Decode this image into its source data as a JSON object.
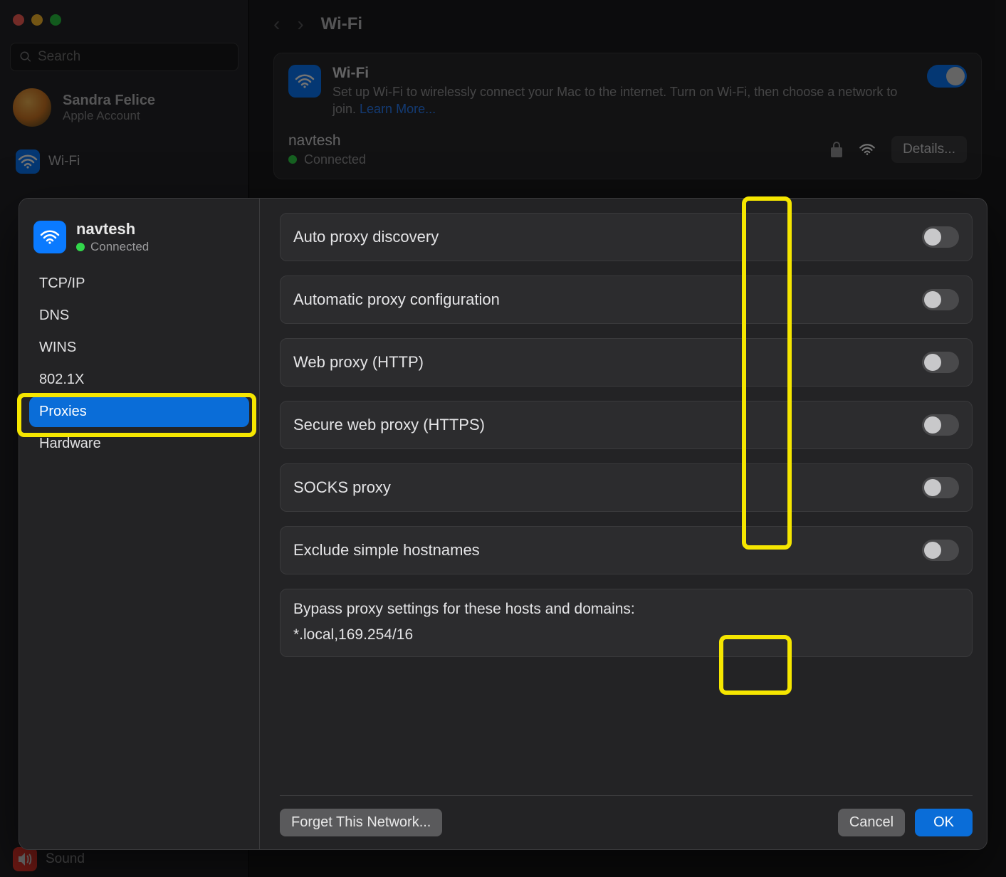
{
  "window": {
    "search_placeholder": "Search",
    "account": {
      "name": "Sandra Felice",
      "subtitle": "Apple Account"
    },
    "nav_wifi": "Wi-Fi",
    "nav_sound": "Sound"
  },
  "main": {
    "title": "Wi-Fi",
    "section": {
      "title": "Wi-Fi",
      "desc_prefix": "Set up Wi-Fi to wirelessly connect your Mac to the internet. Turn on Wi-Fi, then choose a network to join. ",
      "learn_more": "Learn More..."
    },
    "network": {
      "name": "navtesh",
      "status": "Connected",
      "details": "Details..."
    }
  },
  "sheet": {
    "net_name": "navtesh",
    "net_status": "Connected",
    "tabs": {
      "tcpip": "TCP/IP",
      "dns": "DNS",
      "wins": "WINS",
      "dot1x": "802.1X",
      "proxies": "Proxies",
      "hardware": "Hardware"
    },
    "proxies": {
      "auto_discovery": "Auto proxy discovery",
      "auto_config": "Automatic proxy configuration",
      "http": "Web proxy (HTTP)",
      "https": "Secure web proxy (HTTPS)",
      "socks": "SOCKS proxy",
      "exclude_simple": "Exclude simple hostnames",
      "bypass_label": "Bypass proxy settings for these hosts and domains:",
      "bypass_value": "*.local,169.254/16"
    },
    "buttons": {
      "forget": "Forget This Network...",
      "cancel": "Cancel",
      "ok": "OK"
    }
  }
}
